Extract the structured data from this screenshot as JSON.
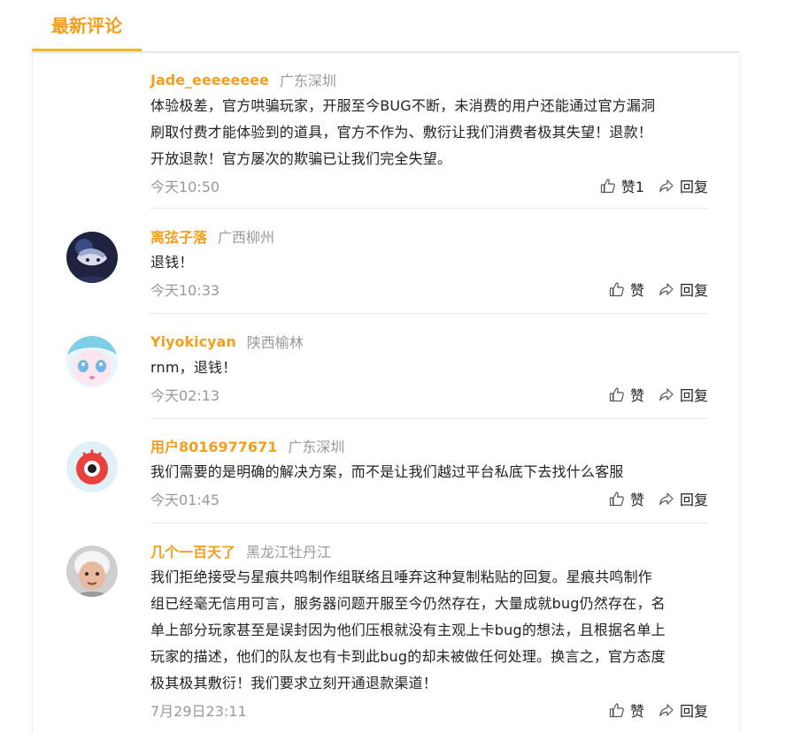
{
  "tab": {
    "label": "最新评论"
  },
  "comments": [
    {
      "username": "Jade_eeeeeeee",
      "location": "广东深圳",
      "lines": [
        "体验极差，官方哄骗玩家，开服至今BUG不断，未消费的用户还能通过官方漏洞",
        "刷取付费才能体验到的道具，官方不作为、敷衍让我们消费者极其失望！退款！",
        "开放退款！官方屡次的欺骗已让我们完全失望。"
      ],
      "time": "今天10:50",
      "like_label": "赞1",
      "reply_label": "回复"
    },
    {
      "username": "离弦子落",
      "location": "广西柳州",
      "lines": [
        "退钱！"
      ],
      "time": "今天10:33",
      "like_label": "赞",
      "reply_label": "回复"
    },
    {
      "username": "Yiyokicyan",
      "location": "陕西榆林",
      "lines": [
        "rnm，退钱！"
      ],
      "time": "今天02:13",
      "like_label": "赞",
      "reply_label": "回复"
    },
    {
      "username": "用户8016977671",
      "location": "广东深圳",
      "lines": [
        "我们需要的是明确的解决方案，而不是让我们越过平台私底下去找什么客服"
      ],
      "time": "今天01:45",
      "like_label": "赞",
      "reply_label": "回复"
    },
    {
      "username": "几个一百天了",
      "location": "黑龙江牡丹江",
      "lines": [
        "我们拒绝接受与星痕共鸣制作组联络且唾弃这种复制粘贴的回复。星痕共鸣制作",
        "组已经毫无信用可言，服务器问题开服至今仍然存在，大量成就bug仍然存在，名",
        "单上部分玩家甚至是误封因为他们压根就没有主观上卡bug的想法，且根据名单上",
        "玩家的描述，他们的队友也有卡到此bug的却未被做任何处理。换言之，官方态度",
        "极其极其敷衍！我们要求立刻开通退款渠道！"
      ],
      "time": "7月29日23:11",
      "like_label": "赞",
      "reply_label": "回复"
    }
  ]
}
